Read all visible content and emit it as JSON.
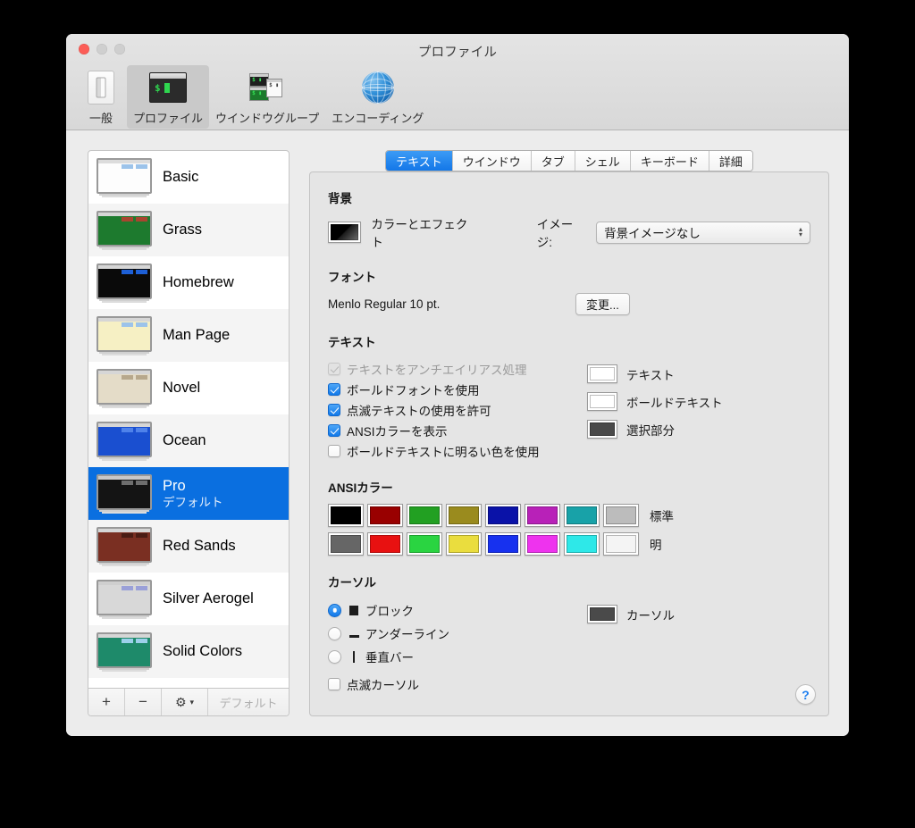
{
  "window": {
    "title": "プロファイル",
    "traffic_lights": [
      "close",
      "minimize",
      "zoom"
    ]
  },
  "toolbar": {
    "items": [
      {
        "label": "一般",
        "icon": "general-icon",
        "selected": false
      },
      {
        "label": "プロファイル",
        "icon": "terminal-icon",
        "selected": true
      },
      {
        "label": "ウインドウグループ",
        "icon": "window-group-icon",
        "selected": false
      },
      {
        "label": "エンコーディング",
        "icon": "globe-icon",
        "selected": false
      }
    ]
  },
  "profiles": {
    "items": [
      {
        "name": "Basic",
        "subtitle": "",
        "selected": false,
        "thumb": {
          "bg": "#fdfdfd",
          "titlebar": "#dcdcdc",
          "text": "#3a4a6a",
          "accent": "#9cc3ea",
          "accent2": "#b8d4ef"
        }
      },
      {
        "name": "Grass",
        "subtitle": "",
        "selected": false,
        "thumb": {
          "bg": "#1d7a2e",
          "titlebar": "#d6d6d6",
          "text": "#d8e8c8",
          "accent": "#a8452f",
          "accent2": "#9c4430"
        }
      },
      {
        "name": "Homebrew",
        "subtitle": "",
        "selected": false,
        "thumb": {
          "bg": "#0a0a0a",
          "titlebar": "#d6d6d6",
          "text": "#2bd441",
          "accent": "#1d5fd6",
          "accent2": "#2a6de0"
        }
      },
      {
        "name": "Man Page",
        "subtitle": "",
        "selected": false,
        "thumb": {
          "bg": "#f6f0c4",
          "titlebar": "#d6d6d6",
          "text": "#4a4a30",
          "accent": "#9cc3ea",
          "accent2": "#b8d4ef"
        }
      },
      {
        "name": "Novel",
        "subtitle": "",
        "selected": false,
        "thumb": {
          "bg": "#e4dcc8",
          "titlebar": "#d6d6d6",
          "text": "#6b4a3a",
          "accent": "#b7a88c",
          "accent2": "#c5b79c"
        }
      },
      {
        "name": "Ocean",
        "subtitle": "",
        "selected": false,
        "thumb": {
          "bg": "#1a4fd0",
          "titlebar": "#d6d6d6",
          "text": "#e0ecff",
          "accent": "#4f82ea",
          "accent2": "#6a97f0"
        }
      },
      {
        "name": "Pro",
        "subtitle": "デフォルト",
        "selected": true,
        "thumb": {
          "bg": "#141414",
          "titlebar": "#c8c8c8",
          "text": "#cfcfcf",
          "accent": "#6e6e6e",
          "accent2": "#868686"
        }
      },
      {
        "name": "Red Sands",
        "subtitle": "",
        "selected": false,
        "thumb": {
          "bg": "#7a2f22",
          "titlebar": "#d6d6d6",
          "text": "#e8c9a8",
          "accent": "#4a1c14",
          "accent2": "#5a241a"
        }
      },
      {
        "name": "Silver Aerogel",
        "subtitle": "",
        "selected": false,
        "thumb": {
          "bg": "#d8d8d8",
          "titlebar": "#cfcfcf",
          "text": "#444444",
          "accent": "#9aa0d8",
          "accent2": "#b0b5e2"
        }
      },
      {
        "name": "Solid Colors",
        "subtitle": "",
        "selected": false,
        "thumb": {
          "bg": "#1e8a6a",
          "titlebar": "#d6d6d6",
          "text": "#d8f0e4",
          "accent": "#9cd0ea",
          "accent2": "#b2dcef"
        }
      }
    ],
    "toolbar": {
      "add_label": "+",
      "remove_label": "−",
      "gear_label": "⚙",
      "gear_caret": "▾",
      "default_label": "デフォルト"
    },
    "selection_color": "#0a6fe0"
  },
  "tabs": [
    {
      "label": "テキスト",
      "active": true
    },
    {
      "label": "ウインドウ",
      "active": false
    },
    {
      "label": "タブ",
      "active": false
    },
    {
      "label": "シェル",
      "active": false
    },
    {
      "label": "キーボード",
      "active": false
    },
    {
      "label": "詳細",
      "active": false
    }
  ],
  "background_section": {
    "title": "背景",
    "color_effects_label": "カラーとエフェクト",
    "color_swatch": "#000000",
    "image_label": "イメージ:",
    "image_value": "背景イメージなし",
    "popup_arrows": "▴▾"
  },
  "font_section": {
    "title": "フォント",
    "font_value": "Menlo Regular 10 pt.",
    "change_button": "変更..."
  },
  "text_section": {
    "title": "テキスト",
    "checkboxes": [
      {
        "label": "テキストをアンチエイリアス処理",
        "checked": true,
        "disabled": true
      },
      {
        "label": "ボールドフォントを使用",
        "checked": true,
        "disabled": false
      },
      {
        "label": "点滅テキストの使用を許可",
        "checked": true,
        "disabled": false
      },
      {
        "label": "ANSIカラーを表示",
        "checked": true,
        "disabled": false
      },
      {
        "label": "ボールドテキストに明るい色を使用",
        "checked": false,
        "disabled": false
      }
    ],
    "swatches": [
      {
        "label": "テキスト",
        "color": "#ffffff"
      },
      {
        "label": "ボールドテキスト",
        "color": "#ffffff"
      },
      {
        "label": "選択部分",
        "color": "#4a4a4a"
      }
    ]
  },
  "ansi_section": {
    "title": "ANSIカラー",
    "normal_label": "標準",
    "bright_label": "明",
    "normal_colors": [
      "#000000",
      "#990000",
      "#22a022",
      "#9a8b1e",
      "#0a12a8",
      "#b821b8",
      "#18a2a8",
      "#bcbcbc"
    ],
    "bright_colors": [
      "#666666",
      "#e81111",
      "#2ad441",
      "#eadd3e",
      "#1731ef",
      "#ee33ee",
      "#2ee8e8",
      "#f4f4f4"
    ]
  },
  "cursor_section": {
    "title": "カーソル",
    "options": [
      {
        "label": "ブロック",
        "glyph": "block",
        "selected": true
      },
      {
        "label": "アンダーライン",
        "glyph": "underline",
        "selected": false
      },
      {
        "label": "垂直バー",
        "glyph": "bar",
        "selected": false
      }
    ],
    "blink_label": "点滅カーソル",
    "blink_checked": false,
    "swatch_label": "カーソル",
    "swatch_color": "#4a4a4a"
  },
  "help": {
    "label": "?"
  }
}
